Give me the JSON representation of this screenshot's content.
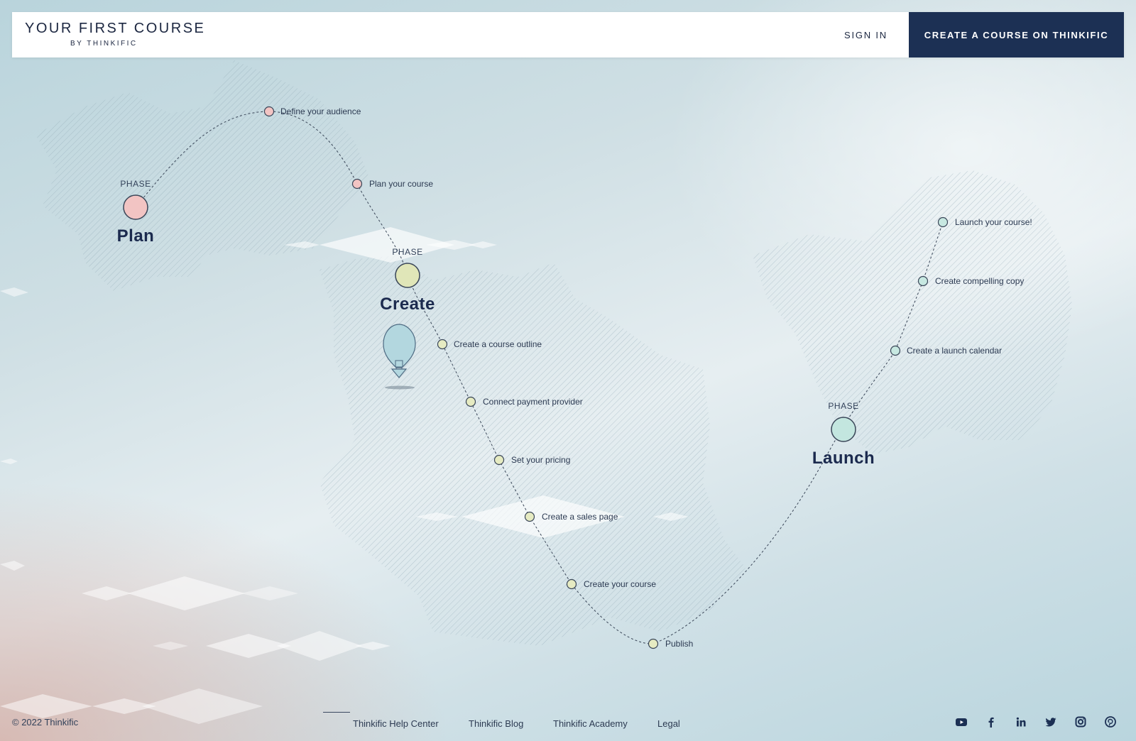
{
  "header": {
    "title": "YOUR FIRST COURSE",
    "subtitle": "BY THINKIFIC",
    "sign_in": "SIGN IN",
    "cta": "CREATE A COURSE ON THINKIFIC"
  },
  "phases": {
    "plan": {
      "tag": "PHASE",
      "name": "Plan",
      "color": "#f2c4c3"
    },
    "create": {
      "tag": "PHASE",
      "name": "Create",
      "color": "#e0e6b8"
    },
    "launch": {
      "tag": "PHASE",
      "name": "Launch",
      "color": "#c3e6df"
    }
  },
  "steps": {
    "define_audience": "Define your audience",
    "plan_course": "Plan your course",
    "course_outline": "Create a course outline",
    "payment_provider": "Connect payment provider",
    "pricing": "Set your pricing",
    "sales_page": "Create a sales page",
    "create_course": "Create your course",
    "publish": "Publish",
    "launch_calendar": "Create a launch calendar",
    "compelling_copy": "Create compelling copy",
    "launch_course": "Launch your course!"
  },
  "footer": {
    "copyright": "© 2022 Thinkific",
    "links": [
      "Thinkific Help Center",
      "Thinkific Blog",
      "Thinkific Academy",
      "Legal"
    ],
    "social_icons": [
      "youtube-icon",
      "facebook-icon",
      "linkedin-icon",
      "twitter-icon",
      "instagram-icon",
      "pinterest-icon"
    ]
  },
  "colors": {
    "navy": "#1c3054",
    "path": "#3a4658",
    "pink_dot": "#f2c4c3",
    "yellow_dot": "#e6ebc2",
    "teal_dot": "#c7e8e1"
  }
}
